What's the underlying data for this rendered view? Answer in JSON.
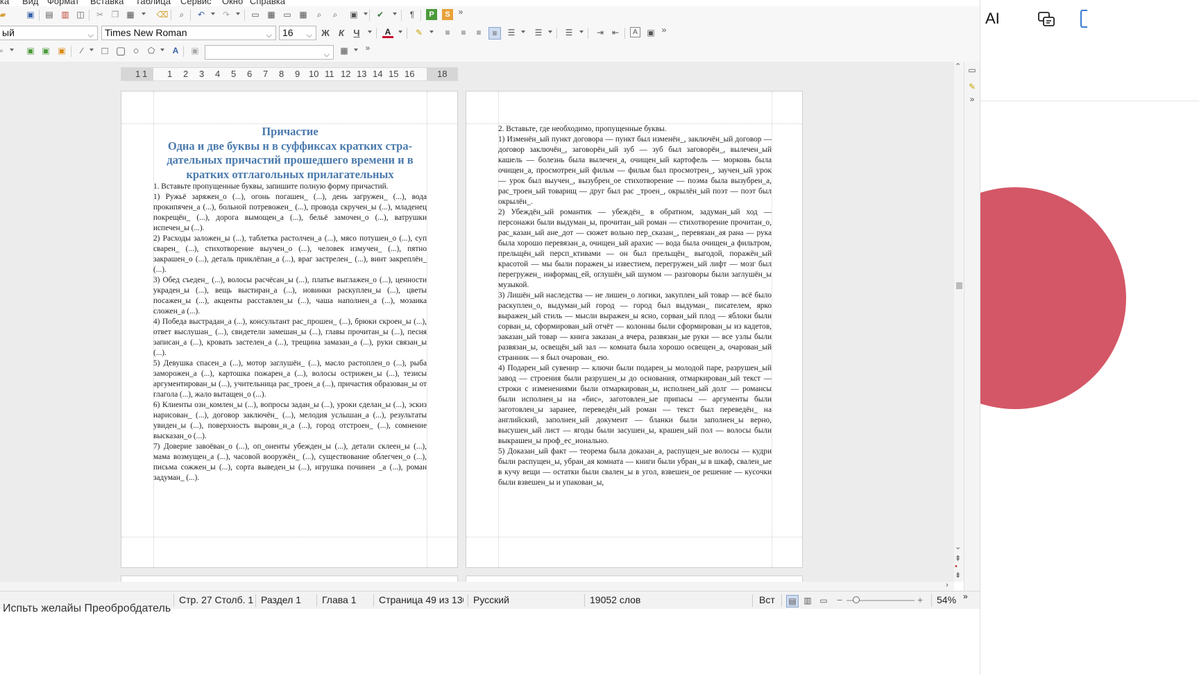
{
  "menu": [
    "ка",
    "Вид",
    "Формат",
    "Вставка",
    "Таблица",
    "Сервис",
    "Окно",
    "Справка"
  ],
  "formatting": {
    "paragraph_style": "ый",
    "font_name": "Times New Roman",
    "font_size": "16",
    "bold_label": "Ж",
    "italic_label": "К",
    "underline_label": "Ч",
    "font_color_label": "А",
    "pilcrow": "¶",
    "draw_combo_value": ""
  },
  "ruler": [
    "1",
    "1",
    "1",
    "2",
    "3",
    "4",
    "5",
    "6",
    "7",
    "8",
    "9",
    "10",
    "11",
    "12",
    "13",
    "14",
    "15",
    "16",
    "18"
  ],
  "page_left": {
    "title_lines": [
      "Причастие",
      "Одна и две буквы н в суффиксах кратких стра-",
      "дательных причастий прошедшего времени и в",
      "кратких отглагольных прилагательных"
    ],
    "paragraphs": [
      "1. Вставьте пропущенные буквы, запишите полную форму причастий.",
      "1) Ружьё заряжен_о (...), огонь погашен_ (...), день загружен_ (...), вода прокипячен_а (...), больной потревожен_ (...), провода скручен_ы (...), младенец покрещён_ (...), дорога вымощен_а (...), бельё замочен_о (...), ватрушки испечен_ы (...).",
      "2) Расходы заложен_ы (...), таблетка растолчен_а (...), мясо потушен_о (...), суп сварен_ (...), стихотворение выучен_о (...), человек измучен_ (...), пятно закрашен_о (...), деталь приклёпан_а (...), враг застрелен_ (...), винт закреплён_ (...).",
      "3) Обед съеден_ (...), волосы расчёсан_ы (...), платье выглажен_о (...), ценности украден_ы (...), вещь выстиран_а (...), новинки раскуплен_ы (...), цветы посажен_ы (...), акценты расставлен_ы (...), чаша наполнен_а (...), мозаика сложен_а (...).",
      "4) Победа выстрадан_а (...), консультант рас_прошен_ (...), брюки скроен_ы (...), ответ выслушан_ (...), свидетели замешан_ы (...), главы прочитан_ы (...), песня записан_а (...), кровать застелен_а (...), трещина замазан_а (...), руки связан_ы (...).",
      "5) Девушка спасен_а (...), мотор заглушён_ (...), масло растоплен_о (...), рыба заморожен_а (...), картошка пожарен_а (...), волосы острижен_ы (...), тезисы аргументирован_ы (...), учительница рас_троен_а (...), причастия образован_ы от глагола (...), жало вытащен_о (...).",
      "6) Клиенты озн_комлен_ы (...), вопросы задан_ы (...), уроки сделан_ы (...), эскиз нарисован_ (...), договор заключён_ (...), мелодия услышан_а (...), результаты увиден_ы (...), поверхность выровн_н_а (...), город отстроен_ (...), сомнение высказан_о (...).",
      "7) Доверие завоёван_о (...), оп_оненты убежден_ы (...), детали склеен_ы (...), мама возмущен_а (...), часовой вооружён_ (...), существование облегчен_о (...), письма сожжен_ы (...), сорта выведен_ы (...), игрушка починен _а (...), роман задуман_ (...)."
    ]
  },
  "page_right": {
    "paragraphs": [
      "2. Вставьте, где необходимо, пропущенные буквы.",
      "1) Изменён_ый пункт договора — пункт был изменён_, заключён_ый договор — договор заключён_, заговорён_ый зуб — зуб был заговорён_, вылечен_ый кашель — болезнь была вылечен_а, очищен_ый картофель — морковь была очищен_а, просмотрен_ый фильм — фильм был просмотрен_, заучен_ый урок — урок был выучен_, вызубрен_ое стихотворение — поэма была вызубрен_а, рас_троен_ый товарищ — друг был рас _троен_, окрылён_ый поэт — поэт был окрылён_.",
      "2) Убеждён_ый романтик — убеждён_ в обратном, задуман_ый ход — персонажи были выдуман_ы, прочитан_ый роман — стихотворение прочитан_о, рас_казан_ый ане_дот — сюжет вольно пер_сказан_, перевязан_ая рана — рука была хорошо перевязан_а, очищен_ый арахис — вода была очищен_а фильтром, прельщён_ый персп_ктивами — он был прельщён_ выгодой, поражён_ый красотой — мы были поражен_ы известием, перегружен_ый лифт — мозг был перегружен_ информац_ей, оглушён_ый шумом — разговоры были заглушён_ы музыкой.",
      "3) Лишён_ый наследства — не лишен_о логики, закуплен_ый товар — всё было раскуплен_о, выдуман_ый город — город был выдуман_ писателем, ярко выражен_ый стиль — мысли выражен_ы ясно, сорван_ый плод — яблоки были сорван_ы, сформирован_ый отчёт — колонны были сформирован_ы из кадетов, заказан_ый товар — книга заказан_а вчера, развязан_ые руки — все узлы были развязан_ы, освещён_ый зал — комната была хорошо освещен_а, очарован_ый странник — я был очарован_ ею.",
      "4) Подарен_ый сувенир — ключи были подарен_ы молодой паре, разрушен_ый завод — строения были разрушен_ы до основания, отмаркирован_ый текст — строки с изменениями были отмаркирован_ы, исполнен_ый долг — романсы были исполнен_ы на «бис», заготовлен_ые припасы — аргументы были заготовлен_ы заранее, переведён_ый роман — текст был переведён_ на английский, заполнен_ый документ — бланки были заполнен_ы верно, высушен_ый лист — ягоды были засушен_ы, крашен_ый пол — волосы были выкрашен_ы проф_ес_ионально.",
      "5) Доказан_ый факт — теорема была доказан_а, распущен_ые волосы — кудри были распущен_ы, убран_ая комната — книги были убран_ы в шкаф, свален_ые в кучу вещи — остатки были свален_ы в угол, взвешен_ое решение — кусочки были взвешен_ы и упакован_ы,"
    ]
  },
  "status": {
    "position": "Стр. 27 Столб. 1",
    "section": "Раздел 1",
    "chapter": "Глава 1",
    "page": "Страница 49 из 130",
    "language": "Русский",
    "words": "19052 слов",
    "mode": "Вст",
    "zoom": "54%"
  },
  "below_text": "Испьть желайы Преобробдатель",
  "right_panel": {
    "ai_label": "AI",
    "accent": "#d45767"
  },
  "colors": {
    "title": "#4a7aad",
    "toolbar_bg": "#f7f7f7",
    "doc_bg": "#ececec"
  }
}
